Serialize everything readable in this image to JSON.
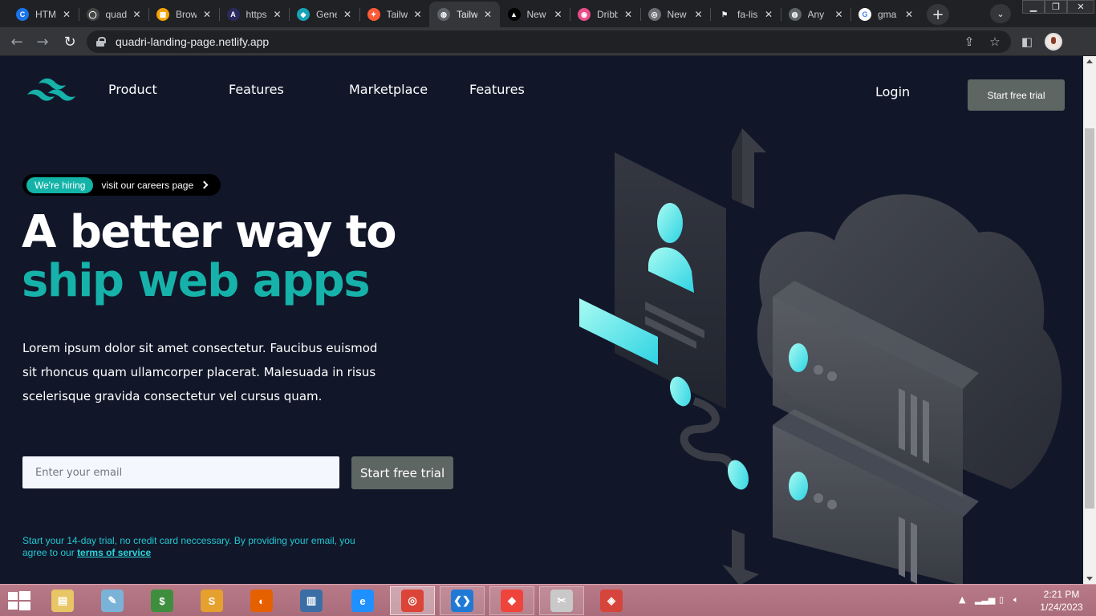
{
  "browser": {
    "tabs": [
      {
        "label": "HTML",
        "icon": "c-logo-icon",
        "color": "#1a73e8",
        "glyph": "C"
      },
      {
        "label": "quadri",
        "icon": "github-icon",
        "color": "#444444",
        "glyph": "◯"
      },
      {
        "label": "Browse",
        "icon": "colorful-grid-icon",
        "color": "#f4a300",
        "glyph": "▦"
      },
      {
        "label": "https",
        "icon": "angular-icon",
        "color": "#2a2a5e",
        "glyph": "A"
      },
      {
        "label": "Gene",
        "icon": "diamond-icon",
        "color": "#17a2b8",
        "glyph": "◆"
      },
      {
        "label": "Tailw",
        "icon": "figma-icon",
        "color": "#ff5a36",
        "glyph": "✦"
      },
      {
        "label": "Tailw",
        "icon": "globe-icon",
        "color": "#5f6368",
        "glyph": "◍",
        "active": true
      },
      {
        "label": "New",
        "icon": "triangle-icon",
        "color": "#000000",
        "glyph": "▲"
      },
      {
        "label": "Dribb",
        "icon": "dribbble-icon",
        "color": "#ea4c89",
        "glyph": "◉"
      },
      {
        "label": "New",
        "icon": "chrome-icon",
        "color": "#6b6e73",
        "glyph": "◎"
      },
      {
        "label": "fa-lis",
        "icon": "flag-icon",
        "color": "#202124",
        "glyph": "⚑"
      },
      {
        "label": "Any",
        "icon": "globe-icon",
        "color": "#5f6368",
        "glyph": "◍"
      },
      {
        "label": "gma",
        "icon": "google-icon",
        "color": "#ffffff",
        "glyph": "G"
      }
    ],
    "close_glyph": "✕",
    "new_tab_glyph": "+",
    "tab_search_glyph": "⌄",
    "url": "quadri-landing-page.netlify.app"
  },
  "nav": {
    "links": [
      "Product",
      "Features",
      "Marketplace",
      "Features"
    ],
    "login": "Login",
    "cta": "Start free trial"
  },
  "hero": {
    "badge": "We're hiring",
    "badge_link": "visit our careers page",
    "headline_line1": "A better way to",
    "headline_line2": "ship web apps",
    "lead": "Lorem ipsum dolor sit amet consectetur. Faucibus euismod sit rhoncus quam ullamcorper placerat. Malesuada in risus scelerisque gravida consectetur vel cursus quam.",
    "email_placeholder": "Enter your email",
    "cta": "Start free trial",
    "fine_print": "Start your 14-day trial, no credit card neccessary. By providing your email, you agree to our",
    "tos": "terms of service"
  },
  "colors": {
    "page_bg": "#111729",
    "accent_teal": "#16b2aa",
    "button_gray": "#5e6663",
    "fine_print_cyan": "#22c7d0",
    "taskbar": "#b97a88"
  },
  "taskbar": {
    "apps": [
      {
        "name": "file-explorer",
        "icon": "folder-icon",
        "color": "#e8c565",
        "glyph": "▤"
      },
      {
        "name": "notepad",
        "icon": "notebook-icon",
        "color": "#7bb3d8",
        "glyph": "✎"
      },
      {
        "name": "money-manager",
        "icon": "money-icon",
        "color": "#3e8e3e",
        "glyph": "$"
      },
      {
        "name": "sublime",
        "icon": "sublime-icon",
        "color": "#e5a02e",
        "glyph": "S"
      },
      {
        "name": "firefox",
        "icon": "firefox-icon",
        "color": "#e66000",
        "glyph": "◐"
      },
      {
        "name": "reader",
        "icon": "reader-icon",
        "color": "#3b6ea5",
        "glyph": "▥"
      },
      {
        "name": "internet-explorer",
        "icon": "ie-icon",
        "color": "#1e90ff",
        "glyph": "e"
      },
      {
        "name": "chrome",
        "icon": "chrome-icon",
        "color": "#db4437",
        "glyph": "◎",
        "state": "active"
      },
      {
        "name": "vscode",
        "icon": "vscode-icon",
        "color": "#1f7ad6",
        "glyph": "❮❯",
        "state": "running"
      },
      {
        "name": "anydesk",
        "icon": "anydesk-icon",
        "color": "#ef443b",
        "glyph": "◆",
        "state": "running"
      },
      {
        "name": "snipping",
        "icon": "scissors-icon",
        "color": "#c9c9c9",
        "glyph": "✂",
        "state": "running"
      },
      {
        "name": "git-gui",
        "icon": "git-icon",
        "color": "#d6453b",
        "glyph": "◈"
      }
    ],
    "time": "2:21 PM",
    "date": "1/24/2023"
  }
}
